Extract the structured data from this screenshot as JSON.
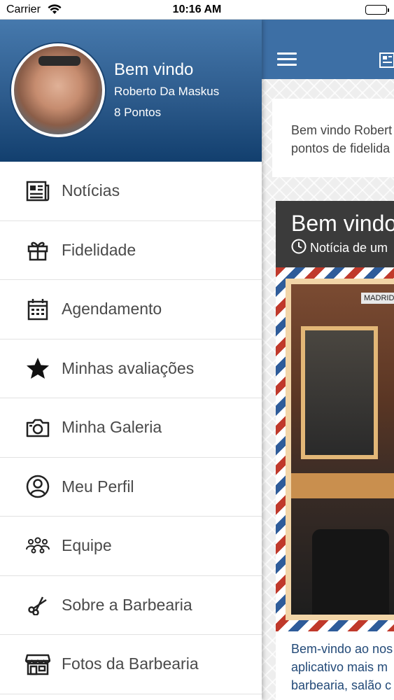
{
  "status_bar": {
    "carrier": "Carrier",
    "time": "10:16 AM"
  },
  "drawer": {
    "welcome": "Bem vindo",
    "user_name": "Roberto Da Maskus",
    "points": "8 Pontos",
    "menu": [
      {
        "label": "Notícias",
        "icon": "newspaper-icon"
      },
      {
        "label": "Fidelidade",
        "icon": "gift-icon"
      },
      {
        "label": "Agendamento",
        "icon": "calendar-icon"
      },
      {
        "label": "Minhas avaliações",
        "icon": "star-icon"
      },
      {
        "label": "Minha Galeria",
        "icon": "camera-icon"
      },
      {
        "label": "Meu Perfil",
        "icon": "user-circle-icon"
      },
      {
        "label": "Equipe",
        "icon": "team-icon"
      },
      {
        "label": "Sobre a Barbearia",
        "icon": "scissors-icon"
      },
      {
        "label": "Fotos da Barbearia",
        "icon": "store-icon"
      }
    ]
  },
  "main": {
    "welcome_card": {
      "line1": "Bem vindo Robert",
      "line2": "pontos de fidelida"
    },
    "news": {
      "title": "Bem vindo",
      "subtitle": "Notícia de um",
      "image_tag": "MADRID",
      "text_line1": "Bem-vindo ao nos",
      "text_line2": "aplicativo mais m",
      "text_line3": "barbearia, salão c"
    }
  },
  "colors": {
    "header_blue": "#3d6fa5",
    "drawer_header_dark": "#123f6e",
    "news_head": "#3b3b3b",
    "news_text": "#234a78"
  }
}
